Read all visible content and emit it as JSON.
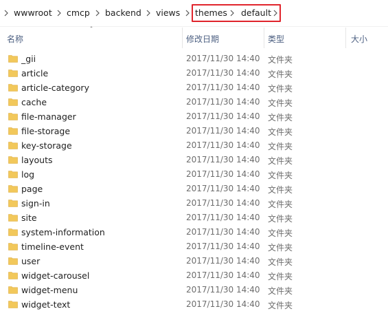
{
  "breadcrumb": {
    "items": [
      "wwwroot",
      "cmcp",
      "backend",
      "views",
      "themes",
      "default"
    ]
  },
  "columns": {
    "name": "名称",
    "date": "修改日期",
    "type": "类型",
    "size": "大小"
  },
  "files": [
    {
      "name": "_gii",
      "date": "2017/11/30 14:40",
      "type": "文件夹"
    },
    {
      "name": "article",
      "date": "2017/11/30 14:40",
      "type": "文件夹"
    },
    {
      "name": "article-category",
      "date": "2017/11/30 14:40",
      "type": "文件夹"
    },
    {
      "name": "cache",
      "date": "2017/11/30 14:40",
      "type": "文件夹"
    },
    {
      "name": "file-manager",
      "date": "2017/11/30 14:40",
      "type": "文件夹"
    },
    {
      "name": "file-storage",
      "date": "2017/11/30 14:40",
      "type": "文件夹"
    },
    {
      "name": "key-storage",
      "date": "2017/11/30 14:40",
      "type": "文件夹"
    },
    {
      "name": "layouts",
      "date": "2017/11/30 14:40",
      "type": "文件夹"
    },
    {
      "name": "log",
      "date": "2017/11/30 14:40",
      "type": "文件夹"
    },
    {
      "name": "page",
      "date": "2017/11/30 14:40",
      "type": "文件夹"
    },
    {
      "name": "sign-in",
      "date": "2017/11/30 14:40",
      "type": "文件夹"
    },
    {
      "name": "site",
      "date": "2017/11/30 14:40",
      "type": "文件夹"
    },
    {
      "name": "system-information",
      "date": "2017/11/30 14:40",
      "type": "文件夹"
    },
    {
      "name": "timeline-event",
      "date": "2017/11/30 14:40",
      "type": "文件夹"
    },
    {
      "name": "user",
      "date": "2017/11/30 14:40",
      "type": "文件夹"
    },
    {
      "name": "widget-carousel",
      "date": "2017/11/30 14:40",
      "type": "文件夹"
    },
    {
      "name": "widget-menu",
      "date": "2017/11/30 14:40",
      "type": "文件夹"
    },
    {
      "name": "widget-text",
      "date": "2017/11/30 14:40",
      "type": "文件夹"
    }
  ],
  "colors": {
    "folder": "#f2c85b",
    "folder_dark": "#dcaa3a",
    "highlight": "#e0242c",
    "header_text": "#4d6082"
  },
  "icons": {
    "breadcrumb_separator": "chevron-right-icon",
    "folder": "folder-icon",
    "sort": "sort-ascending-icon"
  }
}
